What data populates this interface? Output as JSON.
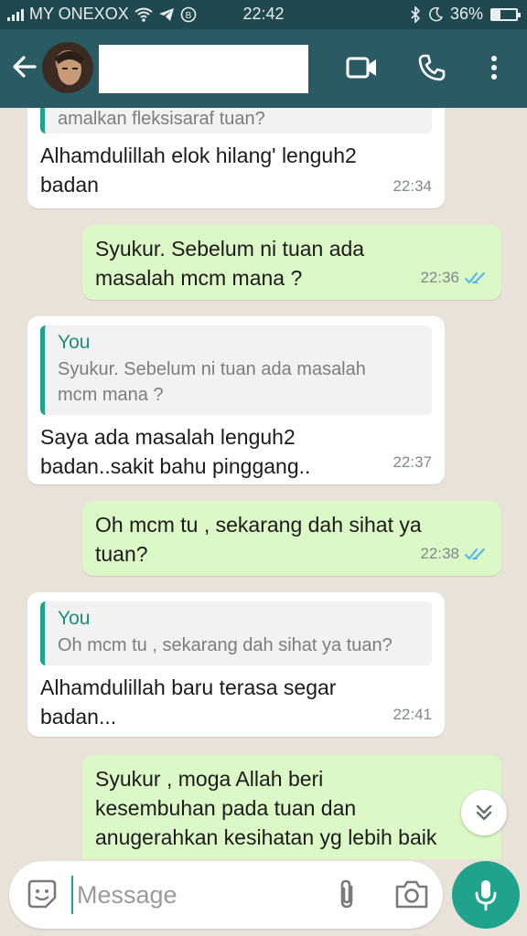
{
  "status_bar": {
    "carrier": "MY ONEXOX",
    "time": "22:42",
    "battery": "36%"
  },
  "header": {
    "contact_name": ""
  },
  "messages": [
    {
      "direction": "in",
      "quote": {
        "text": "amalkan fleksisaraf tuan?"
      },
      "text": "Alhamdulillah elok hilang' lenguh2\nbadan",
      "time": "22:34"
    },
    {
      "direction": "out",
      "text": "Syukur. Sebelum ni tuan ada\nmasalah mcm mana ?",
      "time": "22:36"
    },
    {
      "direction": "in",
      "quote": {
        "author": "You",
        "text": "Syukur. Sebelum ni tuan ada masalah\nmcm mana ?"
      },
      "text": "Saya ada masalah lenguh2\nbadan..sakit bahu pinggang..",
      "time": "22:37"
    },
    {
      "direction": "out",
      "text": "Oh mcm tu , sekarang dah sihat ya\ntuan?",
      "time": "22:38"
    },
    {
      "direction": "in",
      "quote": {
        "author": "You",
        "text": "Oh mcm tu , sekarang dah sihat ya tuan?"
      },
      "text": "Alhamdulillah baru terasa segar\nbadan...",
      "time": "22:41"
    },
    {
      "direction": "out",
      "text": "Syukur , moga Allah beri\nkesembuhan pada tuan dan\nanugerahkan kesihatan yg lebih baik",
      "time": ""
    }
  ],
  "composer": {
    "placeholder": "Message"
  },
  "colors": {
    "appbar": "#2a5b63",
    "statusbar": "#20484f",
    "outgoing_bubble": "#dcf8c6",
    "incoming_bubble": "#ffffff",
    "accent": "#1fa38c",
    "read_ticks": "#4fb6ec"
  },
  "icons": [
    "back-arrow-icon",
    "video-call-icon",
    "phone-icon",
    "more-options-icon",
    "emoji-icon",
    "attach-icon",
    "camera-icon",
    "mic-icon",
    "scroll-down-icon",
    "double-check-icon"
  ]
}
